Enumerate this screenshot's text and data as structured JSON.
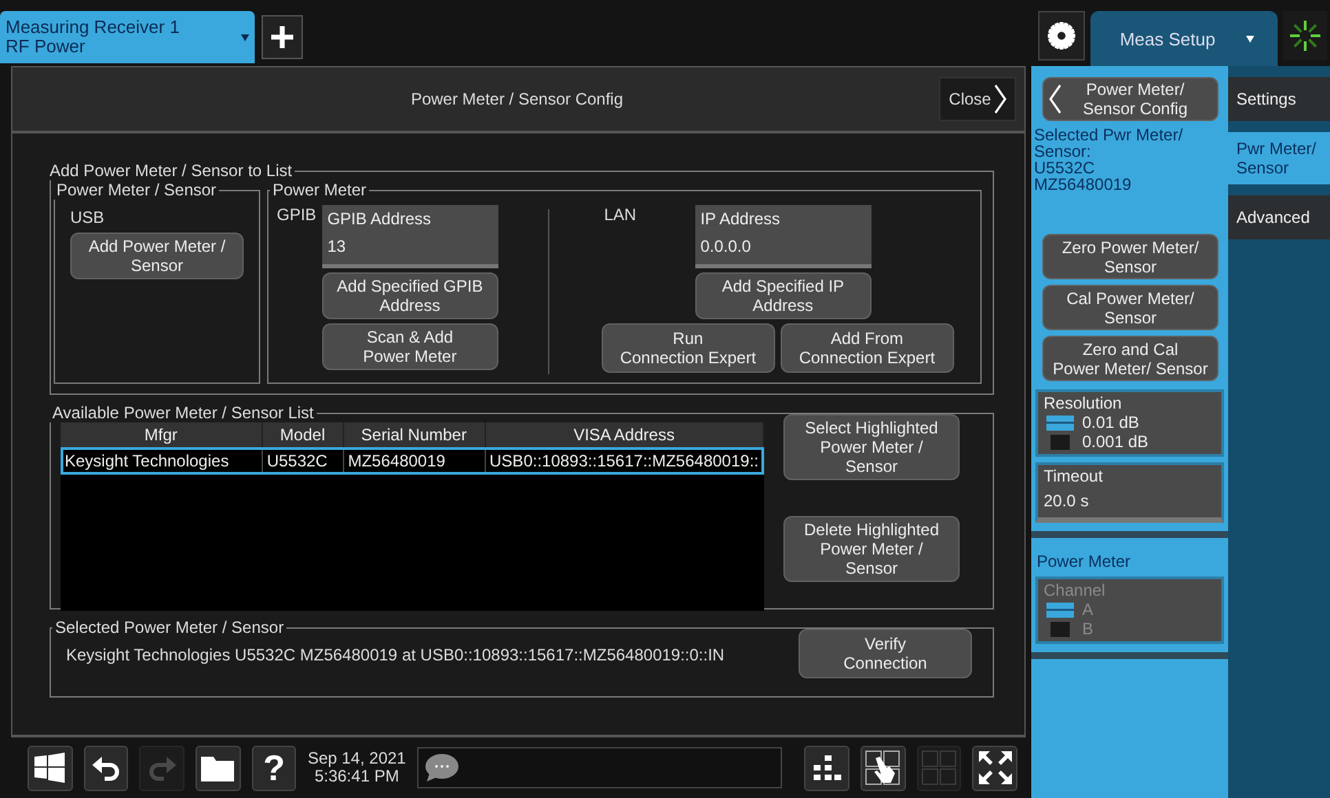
{
  "top_bar": {
    "instrument_tab": {
      "title": "Measuring Receiver 1",
      "subtitle": "RF Power"
    },
    "menu_tab": {
      "label": "Meas Setup"
    }
  },
  "dialog": {
    "title": "Power Meter / Sensor Config",
    "close": "Close",
    "add_group": {
      "legend": "Add Power Meter / Sensor to List",
      "sensor_group": {
        "legend": "Power Meter / Sensor",
        "usb_label": "USB",
        "add_button": "Add Power Meter /\nSensor"
      },
      "meter_group": {
        "legend": "Power Meter",
        "gpib_label": "GPIB",
        "gpib_field": {
          "label": "GPIB Address",
          "value": "13"
        },
        "gpib_buttons": [
          "Add Specified GPIB\nAddress",
          "Scan & Add\nPower Meter"
        ],
        "lan_label": "LAN",
        "ip_field": {
          "label": "IP Address",
          "value": "0.0.0.0"
        },
        "ip_button": "Add Specified IP\nAddress",
        "lan_buttons": [
          "Run\nConnection Expert",
          "Add From\nConnection Expert"
        ]
      }
    },
    "list_group": {
      "legend": "Available Power Meter / Sensor List",
      "columns": [
        "Mfgr",
        "Model",
        "Serial Number",
        "VISA Address"
      ],
      "rows": [
        {
          "cells": [
            "Keysight Technologies",
            "U5532C",
            "MZ56480019",
            "USB0::10893::15617::MZ56480019::"
          ],
          "selected": true
        }
      ],
      "buttons": [
        "Select Highlighted\nPower Meter /\nSensor",
        "Delete Highlighted\nPower Meter /\nSensor"
      ]
    },
    "selected_group": {
      "legend": "Selected Power Meter / Sensor",
      "text": "Keysight Technologies U5532C MZ56480019 at USB0::10893::15617::MZ56480019::0::IN",
      "button": "Verify\nConnection"
    }
  },
  "side_panel": {
    "back_button": "Power Meter/\nSensor Config",
    "info": "Selected Pwr Meter/\nSensor:\nU5532C\nMZ56480019",
    "buttons": [
      "Zero Power Meter/\nSensor",
      "Cal Power Meter/\nSensor",
      "Zero and Cal\nPower Meter/ Sensor"
    ],
    "resolution": {
      "label": "Resolution",
      "options": [
        {
          "label": "0.01 dB",
          "selected": true
        },
        {
          "label": "0.001 dB",
          "selected": false
        }
      ]
    },
    "timeout": {
      "label": "Timeout",
      "value": "20.0 s"
    },
    "section": "Power Meter",
    "channel": {
      "label": "Channel",
      "disabled": true,
      "options": [
        {
          "label": "A",
          "selected": true
        },
        {
          "label": "B",
          "selected": false
        }
      ]
    }
  },
  "side_tabs": [
    {
      "label": "Settings",
      "selected": false
    },
    {
      "label": "Pwr Meter/\nSensor",
      "selected": true
    },
    {
      "label": "Advanced",
      "selected": false
    }
  ],
  "taskbar": {
    "left_buttons": [
      {
        "kind": "windows",
        "disabled": false
      },
      {
        "kind": "undo",
        "disabled": false
      },
      {
        "kind": "redo",
        "disabled": true
      },
      {
        "kind": "folder",
        "disabled": false
      },
      {
        "kind": "help",
        "label": "?",
        "disabled": false
      }
    ],
    "date": "Sep 14, 2021",
    "time": "5:36:41 PM",
    "right_buttons": [
      {
        "kind": "tree",
        "disabled": false
      },
      {
        "kind": "touch",
        "disabled": false
      },
      {
        "kind": "grid",
        "disabled": true
      },
      {
        "kind": "fullscreen",
        "disabled": false
      }
    ]
  }
}
